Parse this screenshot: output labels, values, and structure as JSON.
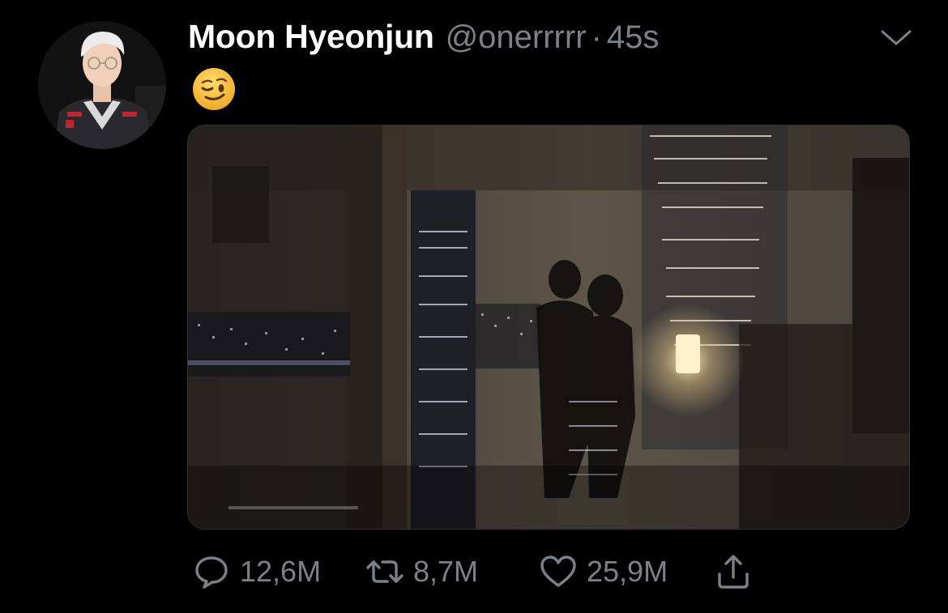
{
  "tweet": {
    "author": {
      "display_name": "Moon Hyeonjun",
      "handle": "@onerrrrr"
    },
    "separator": "·",
    "timestamp": "45s",
    "text_emoji": "winking-face",
    "media": {
      "type": "photo"
    },
    "actions": {
      "replies": "12,6M",
      "retweets": "8,7M",
      "likes": "25,9M"
    }
  },
  "icons": {
    "more": "chevron-down-icon",
    "reply": "speech-bubble-icon",
    "retweet": "retweet-arrows-icon",
    "like": "heart-icon",
    "share": "share-upload-icon"
  },
  "colors": {
    "background": "#000000",
    "primary_text": "#ffffff",
    "secondary_text": "#7b8187",
    "emoji_yellow": "#f7c342"
  }
}
